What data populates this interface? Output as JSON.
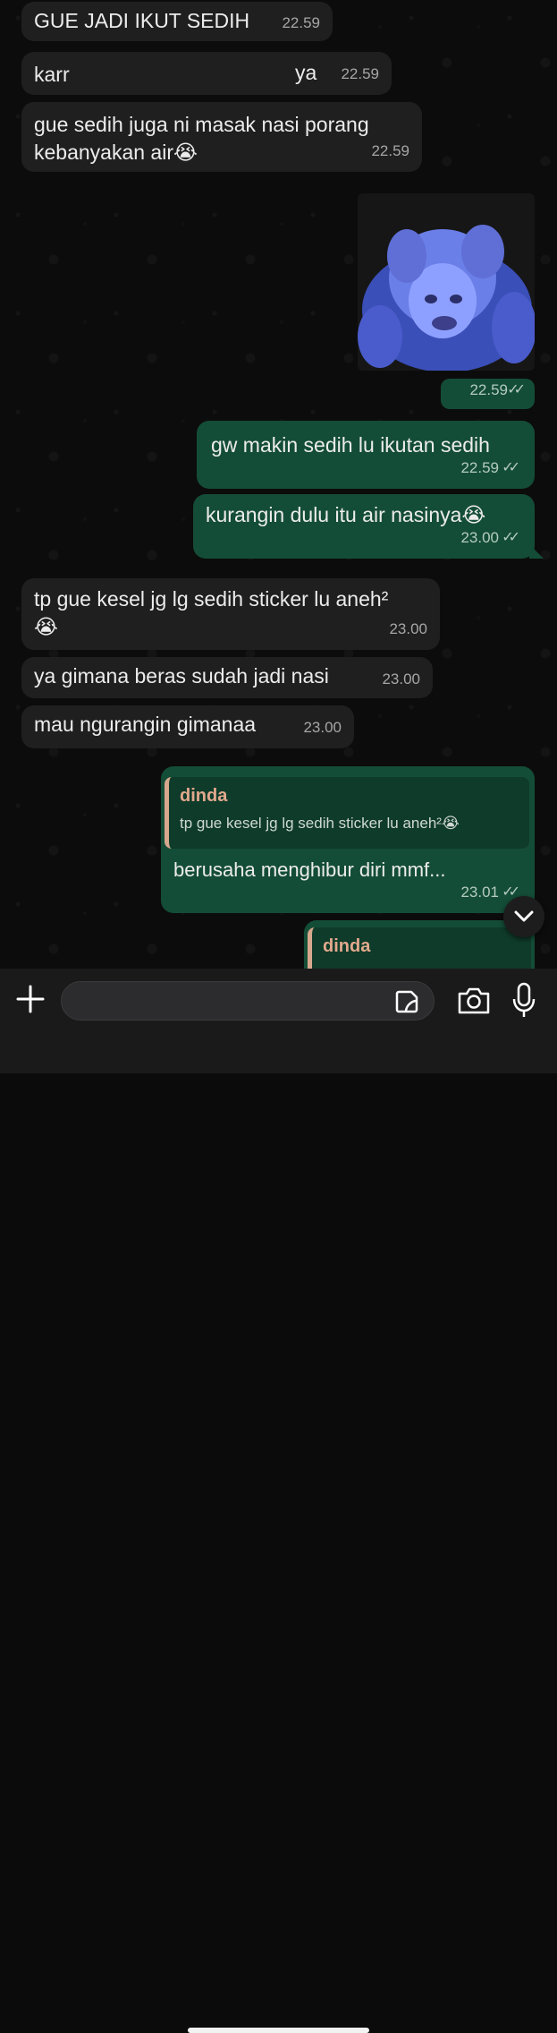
{
  "messages": [
    {
      "dir": "in",
      "text": "GUE JADI IKUT SEDIH",
      "time": "22.59"
    },
    {
      "dir": "in",
      "text_prefix": "karr",
      "text_suffix": "ya",
      "time": "22.59",
      "redacted": true
    },
    {
      "dir": "in",
      "text_line1": "gue sedih juga ni masak nasi porang",
      "text_line2": "kebanyakan air😭",
      "time": "22.59"
    },
    {
      "dir": "out",
      "type": "sticker",
      "time": "22.59",
      "ticks": "✓✓"
    },
    {
      "dir": "out",
      "text": "gw makin sedih lu ikutan sedih",
      "time": "22.59",
      "ticks": "✓✓"
    },
    {
      "dir": "out",
      "text": "kurangin dulu itu air nasinya😭",
      "time": "23.00",
      "ticks": "✓✓"
    },
    {
      "dir": "in",
      "text_line1": "tp gue kesel jg lg sedih sticker lu aneh²",
      "text_line2": "😭",
      "time": "23.00"
    },
    {
      "dir": "in",
      "text": "ya gimana beras sudah jadi nasi",
      "time": "23.00"
    },
    {
      "dir": "in",
      "text": "mau ngurangin gimanaa",
      "time": "23.00"
    },
    {
      "dir": "out",
      "reply_name": "dinda",
      "reply_text": "tp gue kesel jg lg sedih sticker lu aneh²😭",
      "text": "berusaha menghibur diri mmf...",
      "time": "23.01",
      "ticks": "✓✓"
    },
    {
      "dir": "out",
      "reply_name": "dinda",
      "partial": true
    }
  ],
  "composer": {
    "placeholder": "",
    "icons": [
      "plus-icon",
      "sticker-icon",
      "camera-icon",
      "mic-icon"
    ]
  },
  "colors": {
    "incoming": "#1f1f1f",
    "outgoing": "#144d37",
    "read_ticks": "#53bdeb",
    "reply_name": "#e2a98d"
  }
}
